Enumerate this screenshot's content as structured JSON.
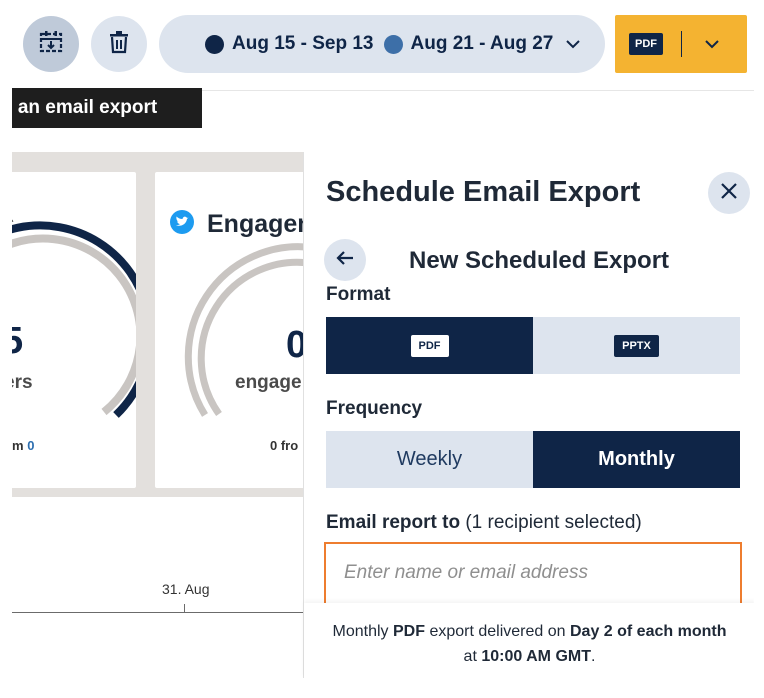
{
  "toolbar": {
    "range_primary": "Aug 15 - Sep 13",
    "range_compare": "Aug 21 - Aug 27",
    "export_format": "PDF",
    "colors": {
      "accent": "#f4b331",
      "navy": "#0f2547",
      "compare": "#3d6fa8"
    }
  },
  "tooltip": {
    "text": "e an email export"
  },
  "dashboard": {
    "card1": {
      "title_fragment": "s",
      "value_fragment": "5",
      "label_fragment": "ers",
      "footer_prefix": "m",
      "footer_value": "0"
    },
    "card2": {
      "title_fragment": "Engagem",
      "value_fragment": "0",
      "label_fragment": "engage",
      "footer_fragment": "0 fro"
    },
    "axis_tick": "31. Aug"
  },
  "panel": {
    "title": "Schedule Email Export",
    "subtitle": "New Scheduled Export",
    "format_label": "Format",
    "format_options": [
      "PDF",
      "PPTX"
    ],
    "format_selected": "PDF",
    "frequency_label": "Frequency",
    "frequency_options": [
      "Weekly",
      "Monthly"
    ],
    "frequency_selected": "Monthly",
    "email_label": "Email report to",
    "email_count": "(1 recipient selected)",
    "email_placeholder": "Enter name or email address",
    "email_value": "",
    "note": {
      "p1": "Monthly ",
      "fmt": "PDF",
      "p2": " export delivered on ",
      "day": "Day 2 of each month",
      "p3": "at ",
      "time": "10:00 AM GMT",
      "p4": "."
    }
  }
}
